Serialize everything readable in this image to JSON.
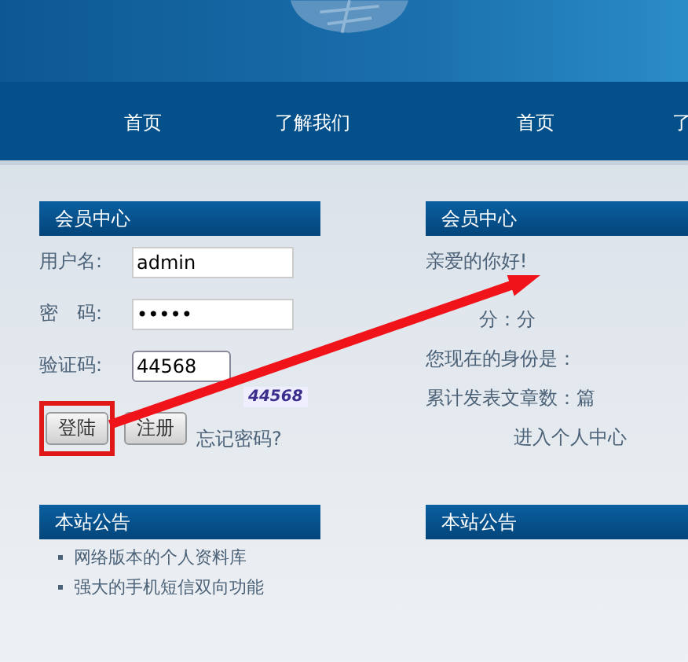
{
  "nav": [
    {
      "label": "首页"
    },
    {
      "label": "了解我们"
    },
    {
      "label": "首页"
    },
    {
      "label": "了"
    }
  ],
  "login_panel": {
    "title": "会员中心",
    "fields": [
      {
        "label": "用户名:",
        "value": "admin",
        "kind": "text"
      },
      {
        "label": "密　码:",
        "value": "•••••",
        "kind": "password"
      },
      {
        "label": "验证码:",
        "value": "44568",
        "kind": "captcha",
        "captcha": "44568"
      }
    ],
    "buttons": [
      {
        "label": "登陆",
        "highlighted": true
      },
      {
        "label": "注册",
        "highlighted": false
      }
    ],
    "forgot_link": "忘记密码?"
  },
  "left_notice": {
    "title": "本站公告",
    "items": [
      "网络版本的个人资料库",
      "强大的手机短信双向功能"
    ]
  },
  "member_panel": {
    "title": "会员中心",
    "lines": [
      {
        "text": "亲爱的你好!"
      },
      {
        "text": "分：分",
        "partly_hidden": true
      },
      {
        "text": "您现在的身份是："
      },
      {
        "text": "累计发表文章数：篇"
      }
    ],
    "link": "进入个人中心"
  },
  "right_notice": {
    "title": "本站公告"
  }
}
